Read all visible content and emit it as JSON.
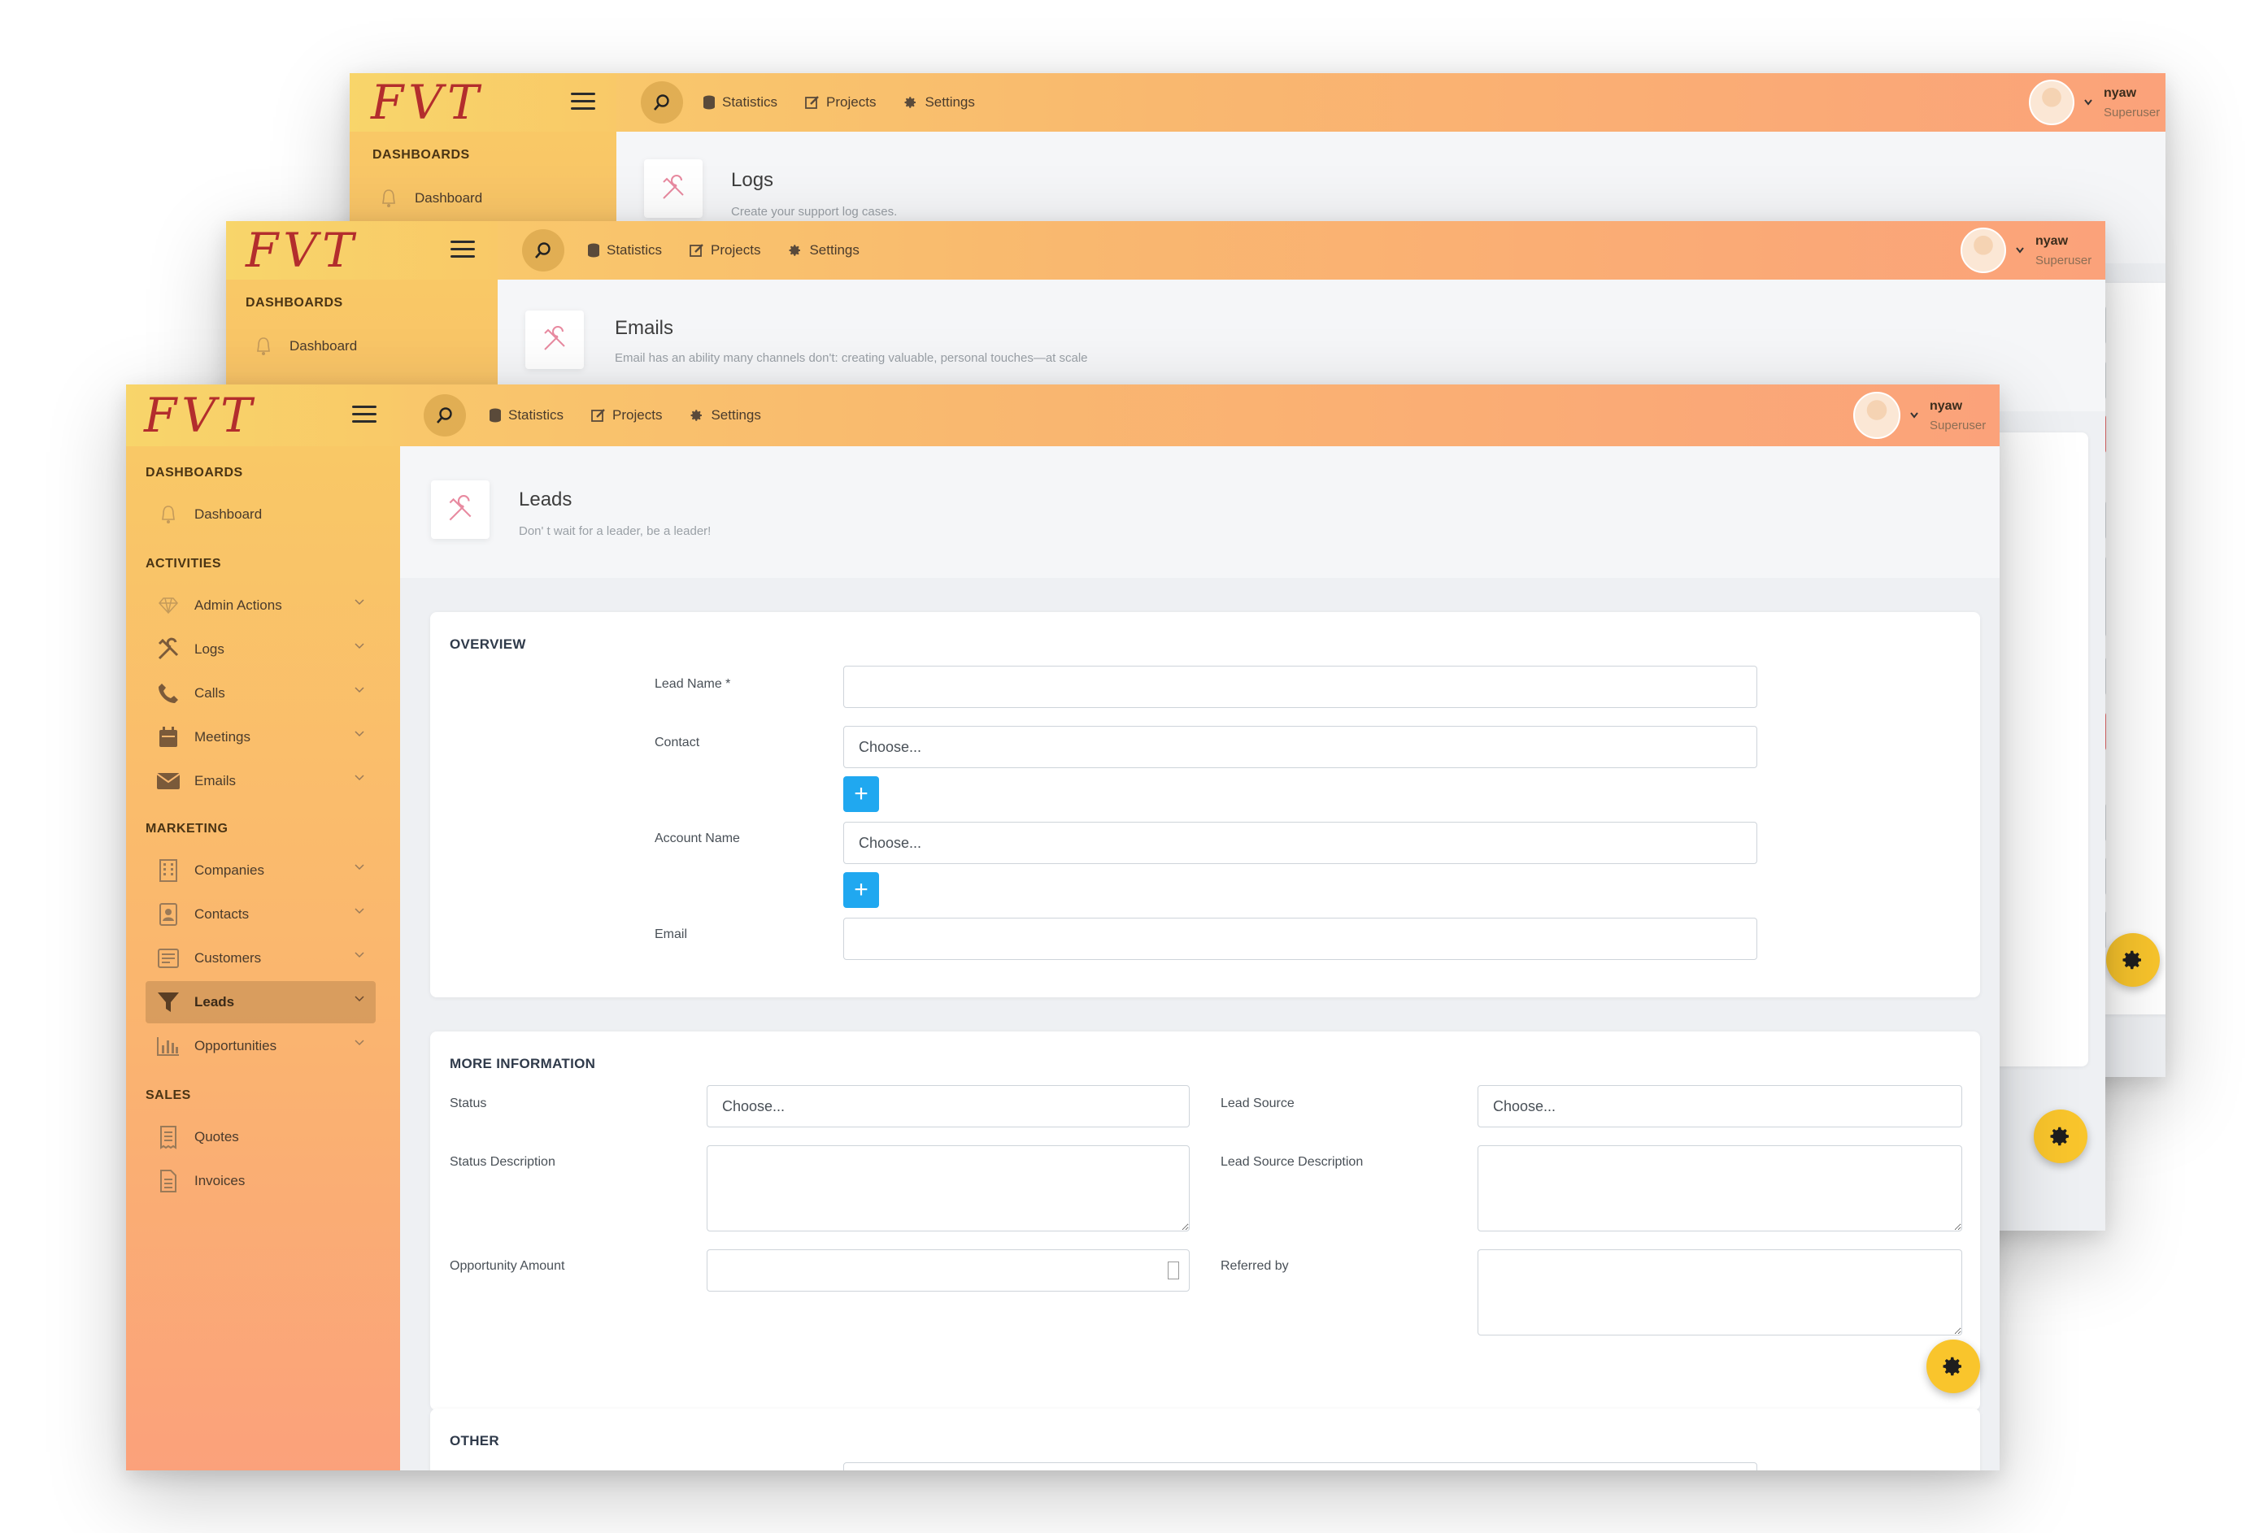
{
  "header": {
    "logo": "FVT",
    "nav": [
      {
        "label": "Statistics",
        "icon": "database-icon"
      },
      {
        "label": "Projects",
        "icon": "edit-icon"
      },
      {
        "label": "Settings",
        "icon": "gear-icon"
      }
    ],
    "user": {
      "name": "nyaw",
      "role": "Superuser"
    }
  },
  "sidebar": {
    "sections": {
      "dashboards": "DASHBOARDS",
      "activities": "ACTIVITIES",
      "marketing": "MARKETING",
      "sales": "SALES"
    },
    "dashboard_item": "Dashboard",
    "activities": [
      "Admin Actions",
      "Logs",
      "Calls",
      "Meetings",
      "Emails"
    ],
    "marketing": [
      "Companies",
      "Contacts",
      "Customers",
      "Leads",
      "Opportunities"
    ],
    "sales": [
      "Quotes",
      "Invoices"
    ],
    "active_item": "Leads"
  },
  "windows": {
    "logs": {
      "title": "Logs",
      "subtitle": "Create your support log cases."
    },
    "emails": {
      "title": "Emails",
      "subtitle": "Email has an ability many channels don't: creating valuable, personal touches—at scale"
    },
    "leads": {
      "title": "Leads",
      "subtitle": "Don' t wait for a leader, be a leader!"
    }
  },
  "form": {
    "overview": {
      "title": "OVERVIEW",
      "lead_name_label": "Lead Name *",
      "contact_label": "Contact",
      "contact_value": "Choose...",
      "account_label": "Account Name",
      "account_value": "Choose...",
      "email_label": "Email",
      "add_symbol": "+"
    },
    "more_info": {
      "title": "MORE INFORMATION",
      "status_label": "Status",
      "status_value": "Choose...",
      "lead_source_label": "Lead Source",
      "lead_source_value": "Choose...",
      "status_desc_label": "Status Description",
      "lead_source_desc_label": "Lead Source Description",
      "opportunity_amount_label": "Opportunity Amount",
      "referred_by_label": "Referred by"
    },
    "other": {
      "title": "OTHER"
    }
  },
  "colors": {
    "header_gradient_start": "#f9cf69",
    "header_gradient_end": "#fba27a",
    "accent_blue": "#20a8f0",
    "fab_yellow": "#f9c52c",
    "logo_red": "#b32d2d"
  }
}
